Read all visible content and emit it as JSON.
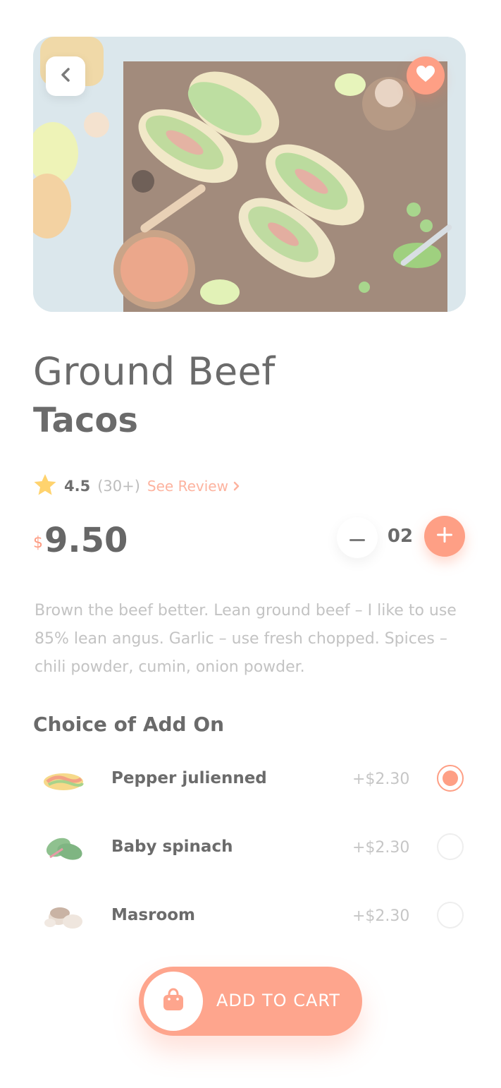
{
  "product": {
    "title_line1": "Ground Beef",
    "title_line2": "Tacos",
    "rating": "4.5",
    "rating_count": "(30+)",
    "see_review": "See Review",
    "currency": "$",
    "price": "9.50",
    "quantity": "02",
    "description": "Brown the beef better. Lean ground beef – I like to use 85% lean angus. Garlic – use fresh  chopped. Spices – chili powder, cumin, onion powder."
  },
  "addons": {
    "title": "Choice of Add On",
    "items": [
      {
        "name": "Pepper  julienned",
        "price": "+$2.30",
        "selected": true
      },
      {
        "name": "Baby spinach",
        "price": "+$2.30",
        "selected": false
      },
      {
        "name": "Masroom",
        "price": "+$2.30",
        "selected": false
      }
    ]
  },
  "cart": {
    "label": "ADD TO CART"
  },
  "colors": {
    "accent": "#fe9f85",
    "star": "#ffd36e",
    "text_dark": "#6b6b6b",
    "text_muted": "#c3c3c3"
  },
  "icons": {
    "back": "chevron-left-icon",
    "favorite": "heart-icon",
    "rating": "star-icon",
    "review_arrow": "chevron-right-icon",
    "minus": "minus-icon",
    "plus": "plus-icon",
    "cart": "shopping-bag-icon"
  }
}
